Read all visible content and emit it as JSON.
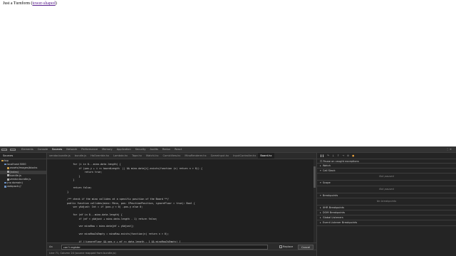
{
  "page": {
    "prefix": "Just a Turnform (",
    "link": "tower-shaped",
    "suffix": ")"
  },
  "devtools": {
    "tabs": [
      "Elements",
      "Console",
      "Sources",
      "Network",
      "Performance",
      "Memory",
      "Application",
      "Security",
      "Audits",
      "Redux",
      "React"
    ],
    "active_tab": "Sources",
    "left": {
      "tab": "Sources",
      "tree": [
        {
          "label": "top",
          "indent": 0,
          "kind": "arrow"
        },
        {
          "label": "localhost:3000",
          "indent": 1,
          "kind": "cloud"
        },
        {
          "label": "assets/images/blocks",
          "indent": 2,
          "kind": "folder"
        },
        {
          "label": "(index)",
          "indent": 2,
          "kind": "file",
          "selected": true
        },
        {
          "label": "bundle.js",
          "indent": 2,
          "kind": "file"
        },
        {
          "label": "vendor.bundle.js",
          "indent": 2,
          "kind": "file"
        },
        {
          "label": "(no domain)",
          "indent": 1,
          "kind": "cloud"
        },
        {
          "label": "webpack://",
          "indent": 1,
          "kind": "cloud"
        }
      ]
    },
    "file_tabs": [
      "vendor.bundle.js",
      "bundle.js",
      "HaOverride.hx",
      "Lambda.hx",
      "Tape.hx",
      "Matchi.hx",
      "ComicView.hx",
      "MinoRenderer.hx",
      "GameInput.hx",
      "InputController.hx",
      "Board.hx"
    ],
    "active_file": "Board.hx",
    "code": [
      {
        "n": "",
        "t": ""
      },
      {
        "n": "",
        "t": "        for (i in 0...mino.data.length) {"
      },
      {
        "n": "",
        "t": "            if (pos.y + i >= boardLength  || && mino.data[i].exists(function (n) return n > 0)) {"
      },
      {
        "n": "",
        "t": "                return true;"
      },
      {
        "n": "",
        "t": "            }"
      },
      {
        "n": "",
        "t": "        }"
      },
      {
        "n": "",
        "t": ""
      },
      {
        "n": "",
        "t": "        return false;"
      },
      {
        "n": "",
        "t": "    }"
      },
      {
        "n": "",
        "t": ""
      },
      {
        "n": "",
        "t": "    /** check if the mino collides at a specific position of the Board **/"
      },
      {
        "n": "",
        "t": "    public function collides(mino: Mino, pos: IPositionPosition, ignoreFloor = true): Bool {"
      },
      {
        "n": "",
        "t": "        var yAdjust: Int = if (pos.y < 0) -pos.y else 0;"
      },
      {
        "n": "",
        "t": ""
      },
      {
        "n": "",
        "t": "        for (mY in 0...mino.data.length) {"
      },
      {
        "n": "",
        "t": "            if (mY < yAdjust + mino.data.length - 1) return false;"
      },
      {
        "n": "",
        "t": ""
      },
      {
        "n": "",
        "t": "            var minoRow = mino.data[mY + yAdjust];"
      },
      {
        "n": "",
        "t": ""
      },
      {
        "n": "",
        "t": "            var minoRowIsEmpty = minoRow.exists(function(n) return n > 0);"
      },
      {
        "n": "",
        "t": ""
      },
      {
        "n": "",
        "t": "            if (!ignoreFloor && pos.y + mY >= data.length - 1 && minoRowIsEmpty) {"
      },
      {
        "n": "",
        "t": "                return true;"
      },
      {
        "n": "",
        "t": "            }"
      },
      {
        "n": "",
        "t": ""
      },
      {
        "n": "",
        "t": "            if (pos.y + mY + yAdjust >= data.length - 1) {"
      }
    ],
    "search": {
      "aa": "Aa",
      "value": "can't register",
      "replace_label": "Replace",
      "cancel_label": "Cancel"
    },
    "status": "Line 71, Column 24   (source mapped from bundle.js)",
    "right": {
      "pause_label": "Pause on caught exceptions",
      "sections": [
        {
          "label": "Watch"
        },
        {
          "label": "Call Stack",
          "open": true,
          "info": "Not paused"
        },
        {
          "label": "Scope",
          "open": true,
          "info": "Not paused"
        },
        {
          "label": "Breakpoints",
          "open": true,
          "info": "No breakpoints"
        },
        {
          "label": "XHR Breakpoints"
        },
        {
          "label": "DOM Breakpoints"
        },
        {
          "label": "Global Listeners"
        },
        {
          "label": "Event Listener Breakpoints"
        }
      ]
    }
  }
}
